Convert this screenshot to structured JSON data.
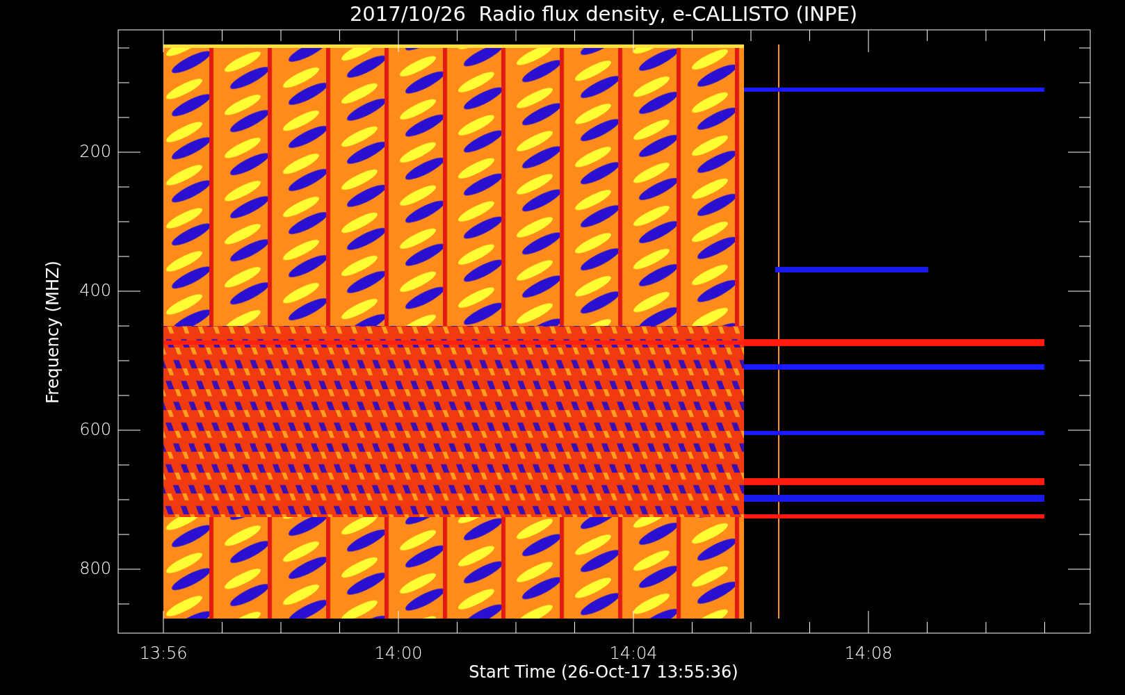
{
  "title": "2017/10/26  Radio flux density, e-CALLISTO (INPE)",
  "y_axis": {
    "label": "Frequency (MHZ)",
    "ticks": [
      "200",
      "400",
      "600",
      "800"
    ]
  },
  "x_axis": {
    "label": "Start Time (26-Oct-17 13:55:36)",
    "ticks": [
      "13:56",
      "14:00",
      "14:04",
      "14:08"
    ]
  }
}
